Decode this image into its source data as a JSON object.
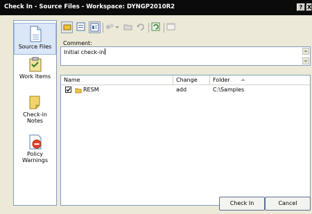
{
  "window": {
    "title": "Check In - Source Files - Workspace: DYNGP2010R2",
    "help_btn": "?",
    "close_btn": "X"
  },
  "sidebar": {
    "items": [
      {
        "label": "Source Files",
        "icon": "source-files-icon",
        "selected": true
      },
      {
        "label": "Work Items",
        "icon": "work-items-icon",
        "selected": false
      },
      {
        "label_line1": "Check-in",
        "label_line2": "Notes",
        "icon": "check-in-notes-icon",
        "selected": false
      },
      {
        "label_line1": "Policy",
        "label_line2": "Warnings",
        "icon": "policy-warnings-icon",
        "selected": false
      }
    ]
  },
  "comment": {
    "label": "Comment:",
    "value": "Initial check-in"
  },
  "list": {
    "columns": [
      "Name",
      "Change",
      "Folder"
    ],
    "rows": [
      {
        "name": "RESM",
        "change": "add",
        "folder": "C:\\Samples",
        "checked": true
      }
    ]
  },
  "buttons": {
    "check_in": "Check In",
    "cancel": "Cancel"
  },
  "colors": {
    "titlebar": "#0b0b0b",
    "panel_bg": "#ece9d8",
    "border": "#7f9db9"
  }
}
